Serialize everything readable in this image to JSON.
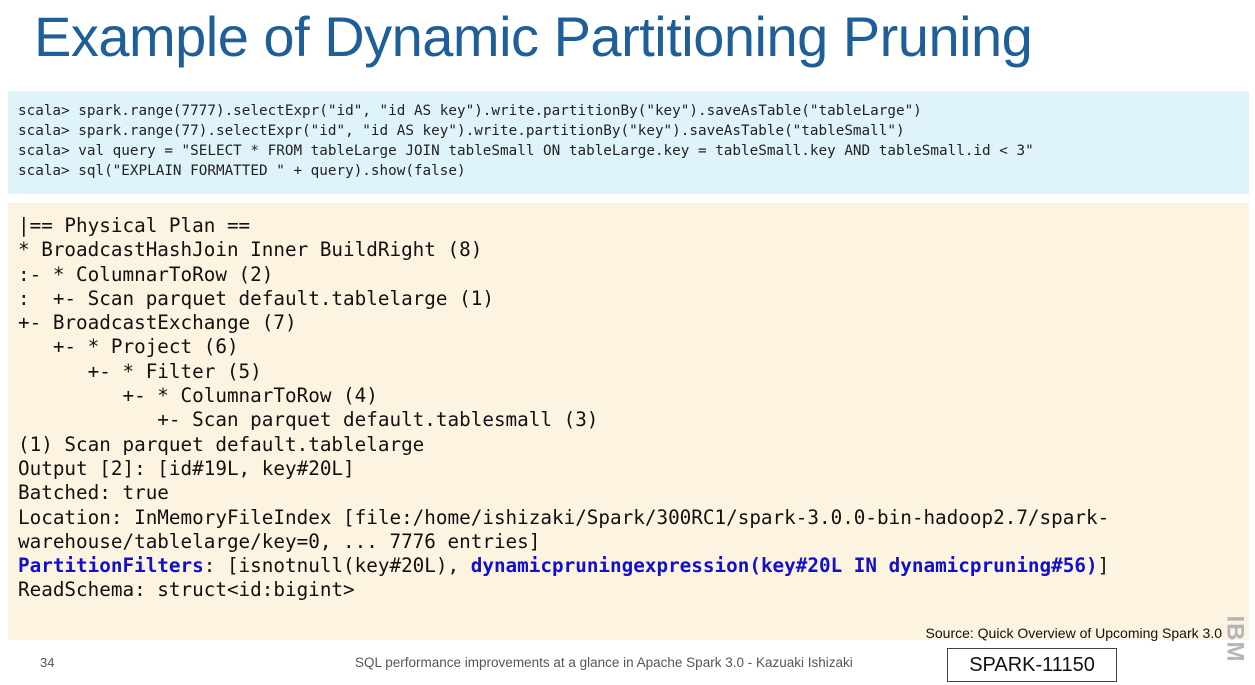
{
  "slide": {
    "title": "Example of Dynamic Partitioning Pruning",
    "code_lines": [
      "scala> spark.range(7777).selectExpr(\"id\", \"id AS key\").write.partitionBy(\"key\").saveAsTable(\"tableLarge\")",
      "scala> spark.range(77).selectExpr(\"id\", \"id AS key\").write.partitionBy(\"key\").saveAsTable(\"tableSmall\")",
      "scala> val query = \"SELECT * FROM tableLarge JOIN tableSmall ON tableLarge.key = tableSmall.key AND tableSmall.id < 3\"",
      "scala> sql(\"EXPLAIN FORMATTED \" + query).show(false)"
    ],
    "plan_lines": [
      "|== Physical Plan ==",
      "* BroadcastHashJoin Inner BuildRight (8)",
      ":- * ColumnarToRow (2)",
      ":  +- Scan parquet default.tablelarge (1)",
      "+- BroadcastExchange (7)",
      "   +- * Project (6)",
      "      +- * Filter (5)",
      "         +- * ColumnarToRow (4)",
      "            +- Scan parquet default.tablesmall (3)",
      "",
      "(1) Scan parquet default.tablelarge",
      "Output [2]: [id#19L, key#20L]",
      "Batched: true",
      "Location: InMemoryFileIndex [file:/home/ishizaki/Spark/300RC1/spark-3.0.0-bin-hadoop2.7/spark-",
      "warehouse/tablelarge/key=0, ... 7776 entries]"
    ],
    "partition_filters": {
      "label": "PartitionFilters",
      "mid": ": [isnotnull(key#20L), ",
      "expression": "dynamicpruningexpression(key#20L IN dynamicpruning#56)",
      "end": "]"
    },
    "read_schema": "ReadSchema: struct<id:bigint>",
    "source": "Source: Quick Overview of Upcoming Spark 3.0",
    "slide_number": "34",
    "footer": "SQL performance improvements at a glance in Apache Spark 3.0 - Kazuaki Ishizaki",
    "jira_label": "SPARK-11150",
    "logo": "IBM",
    "colors": {
      "title": "#1f5f99",
      "code_background": "#dff3fb",
      "plan_background": "#fdf3e1",
      "highlight": "#1010cc"
    }
  }
}
